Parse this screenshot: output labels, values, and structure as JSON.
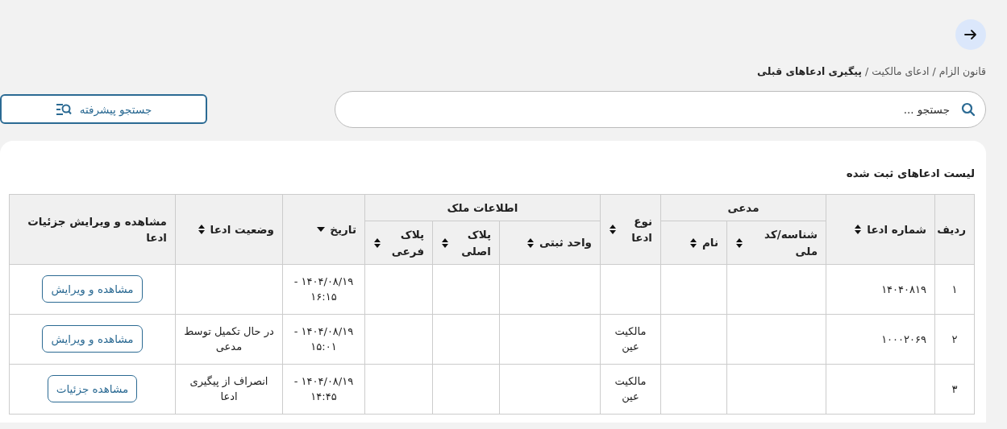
{
  "breadcrumb": {
    "separator": "/",
    "items": [
      {
        "label": "قانون الزام",
        "current": false
      },
      {
        "label": "ادعای مالکیت",
        "current": false
      },
      {
        "label": "پیگیری ادعاهای قبلی",
        "current": true
      }
    ]
  },
  "search": {
    "placeholder": "جستجو ..."
  },
  "advanced_search_button": "جستجو پیشرفته",
  "table": {
    "title": "لیست ادعاهای ثبت شده",
    "columns": [
      {
        "label": "ردیف",
        "sortable": false
      },
      {
        "label": "شماره ادعا",
        "sortable": true,
        "sorted_descending": false
      },
      {
        "label": "مدعی",
        "children": [
          {
            "label": "شناسه/کد ملی",
            "sortable": true,
            "sorted_descending": false
          },
          {
            "label": "نام",
            "sortable": true,
            "sorted_descending": false
          }
        ]
      },
      {
        "label": "نوع ادعا",
        "sortable": true,
        "sorted_descending": false
      },
      {
        "label": "اطلاعات ملک",
        "children": [
          {
            "label": "واحد ثبتی",
            "sortable": true,
            "sorted_descending": false
          },
          {
            "label": "پلاک اصلی",
            "sortable": true,
            "sorted_descending": false
          },
          {
            "label": "پلاک فرعی",
            "sortable": true,
            "sorted_descending": false
          }
        ]
      },
      {
        "label": "تاریخ",
        "sortable": true,
        "sorted_descending": true
      },
      {
        "label": "وضعیت ادعا",
        "sortable": true,
        "sorted_descending": false
      },
      {
        "label": "مشاهده و ویرایش جزئیات ادعا",
        "sortable": false
      }
    ],
    "rows": [
      {
        "row_number": "۱",
        "claim_number": "۱۴۰۴۰۸۱۹",
        "date": "۱۴۰۴/۰۸/۱۹ - ۱۶:۱۵",
        "action": "مشاهده و ویرایش"
      },
      {
        "row_number": "۲",
        "claim_number": "۱۰۰۰۲۰۶۹",
        "claim_type": "مالکیت عین",
        "date": "۱۴۰۴/۰۸/۱۹ - ۱۵:۰۱",
        "status": "در حال تکمیل توسط مدعی",
        "action": "مشاهده و ویرایش"
      },
      {
        "row_number": "۳",
        "claim_type": "مالکیت عین",
        "date": "۱۴۰۴/۰۸/۱۹ - ۱۴:۴۵",
        "status": "انصراف از پیگیری ادعا",
        "action": "مشاهده جزئیات"
      }
    ]
  }
}
